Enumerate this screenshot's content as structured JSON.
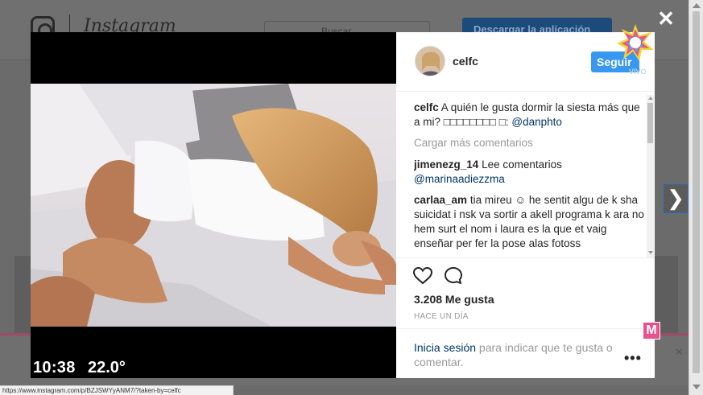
{
  "background": {
    "logo_text": "Instagram",
    "search_placeholder": "Buscar",
    "download_label": "Descargar la aplicación"
  },
  "post": {
    "username": "celfc",
    "follow_label": "Seguir",
    "caption_user": "celfc",
    "caption_text": "A quién le gusta dormir la siesta más que a mi? □□□□□□□□ □: ",
    "caption_mention": "@danphto",
    "load_more": "Cargar más comentarios",
    "comments": [
      {
        "user": "jimenezg_14",
        "text": "Lee comentarios",
        "mention": "@marinaadiezzma"
      },
      {
        "user": "carlaa_am",
        "text": "tia mireu ☺ he sentit algu de k sha suicidat i nsk va sortir a akell programa k ara no hem surt el nom i laura es la que et vaig enseñar per fer la pose alas fotoss",
        "mention": ""
      }
    ],
    "likes": "3.208 Me gusta",
    "time_ago": "HACE UN DÍA",
    "login_link": "Inicia sesión",
    "login_rest": " para indicar que te gusta o comentar.",
    "more_label": "•••"
  },
  "overlay": {
    "close_label": "✕",
    "next_label": "❯",
    "tv_time": "10:38",
    "tv_temp": "22.0°",
    "vivo_label": "VIVO",
    "m_label": "M"
  },
  "status_url": "https://www.instagram.com/p/BZJSWYyANM7/?taken-by=celfc",
  "colors": {
    "follow_blue": "#3897f0",
    "link_navy": "#003569",
    "muted_gray": "#999999"
  }
}
